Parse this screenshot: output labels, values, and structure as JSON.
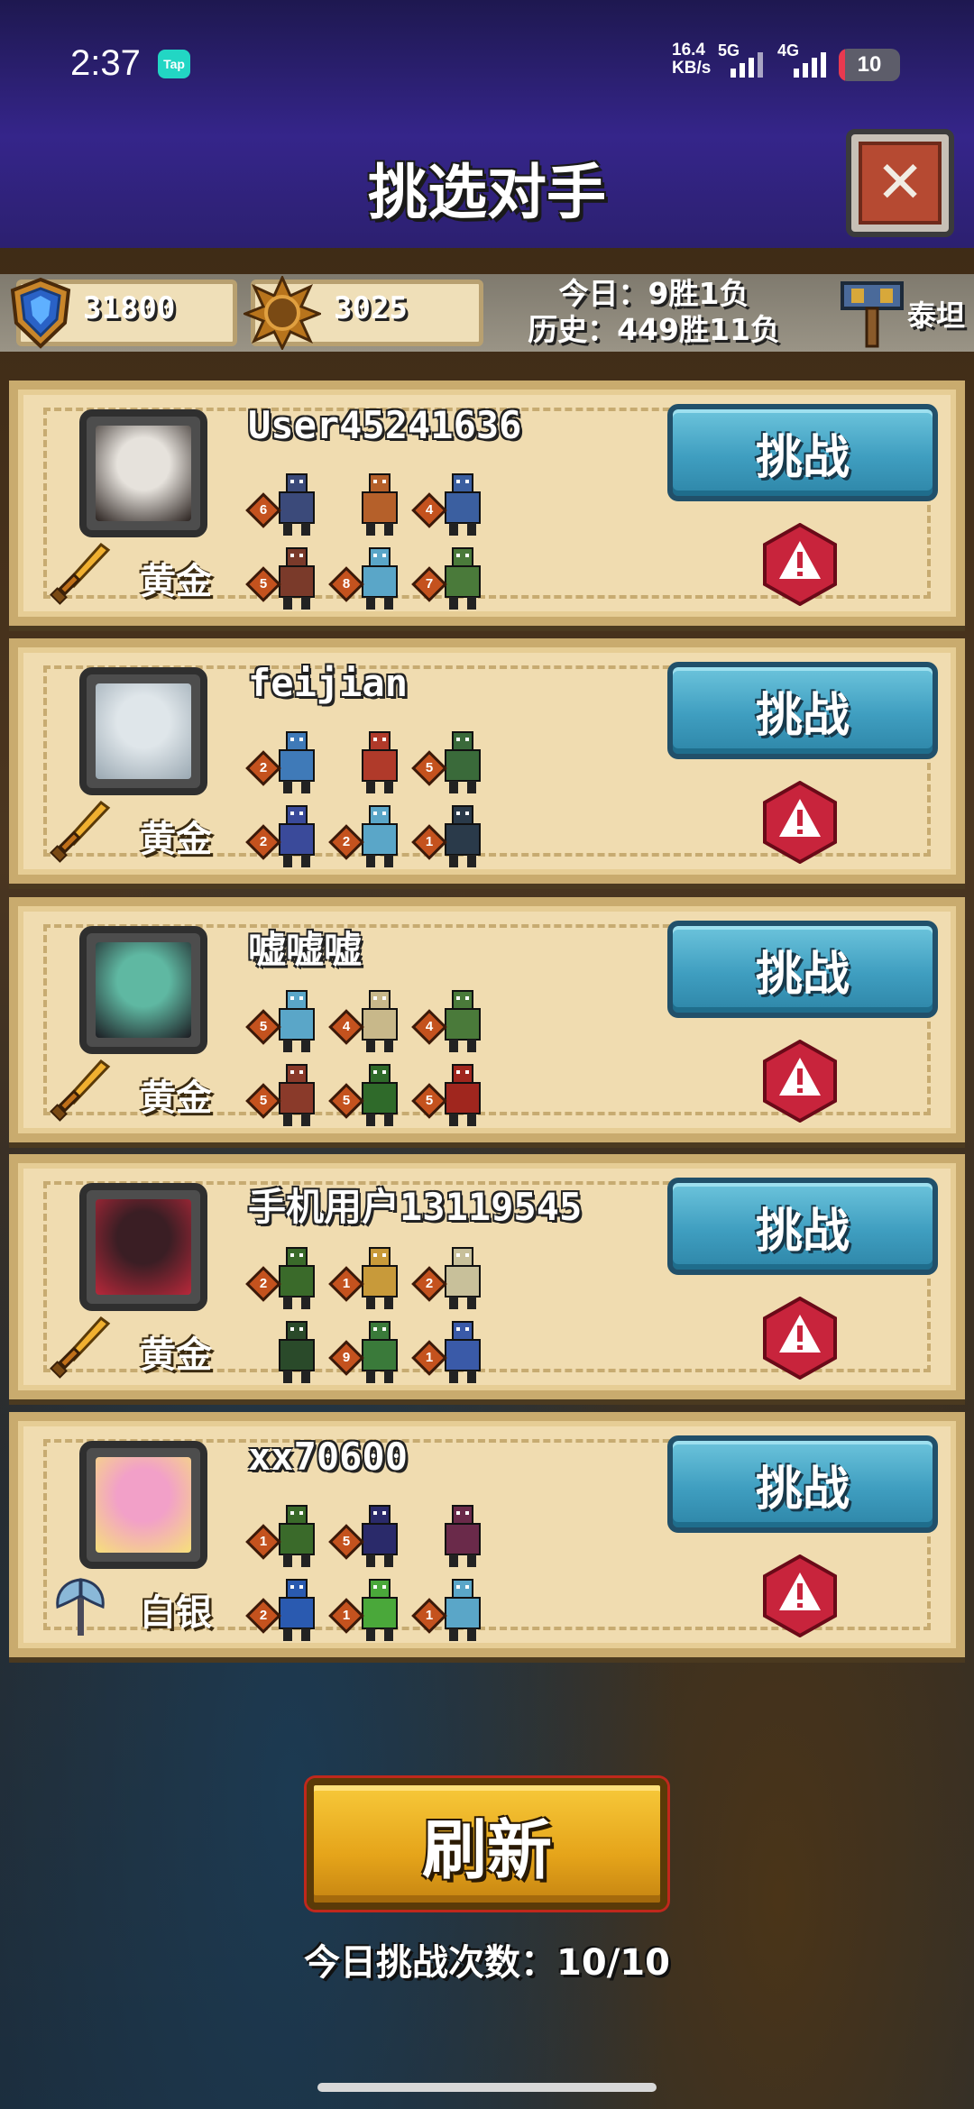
{
  "status_bar": {
    "time": "2:37",
    "app_badge": "Tap",
    "net_speed_value": "16.4",
    "net_speed_unit": "KB/s",
    "net1": "5G",
    "net2": "4G",
    "battery": "10",
    "battery_level_pct": 10
  },
  "header": {
    "title": "挑选对手",
    "close_icon": "close-icon"
  },
  "resources": {
    "trophies": "31800",
    "medals": "3025",
    "today_record": "今日：9胜1负",
    "history_record": "历史：449胜11负",
    "rank": "泰坦"
  },
  "opponents": [
    {
      "name": "User45241636",
      "tier": "黄金",
      "tier_icon": "golden-sword-icon",
      "avatar_colors": [
        "#e6e2dc",
        "#2b2320"
      ],
      "units": [
        {
          "level": "6",
          "color": "#3b4a7a"
        },
        {
          "level": "",
          "color": "#b5602a"
        },
        {
          "level": "4",
          "color": "#3b5fa0"
        },
        {
          "level": "5",
          "color": "#7a3a2a"
        },
        {
          "level": "8",
          "color": "#5aa6c8"
        },
        {
          "level": "7",
          "color": "#4a7a3a"
        }
      ],
      "challenge_label": "挑战"
    },
    {
      "name": "feijian",
      "tier": "黄金",
      "tier_icon": "golden-sword-icon",
      "avatar_colors": [
        "#dfe6ea",
        "#9aa8b2"
      ],
      "units": [
        {
          "level": "2",
          "color": "#3f7ab8"
        },
        {
          "level": "",
          "color": "#b03a2a"
        },
        {
          "level": "5",
          "color": "#3a6a3a"
        },
        {
          "level": "2",
          "color": "#3a4a9a"
        },
        {
          "level": "2",
          "color": "#5aa6c8"
        },
        {
          "level": "1",
          "color": "#2a3a4a"
        }
      ],
      "challenge_label": "挑战"
    },
    {
      "name": "嘘嘘嘘",
      "tier": "黄金",
      "tier_icon": "golden-sword-icon",
      "avatar_colors": [
        "#5fb8a2",
        "#1c1c22"
      ],
      "units": [
        {
          "level": "5",
          "color": "#5aa6c8"
        },
        {
          "level": "4",
          "color": "#c8b88a"
        },
        {
          "level": "4",
          "color": "#4a7a3a"
        },
        {
          "level": "5",
          "color": "#8a3a2a"
        },
        {
          "level": "5",
          "color": "#2f6a2a"
        },
        {
          "level": "5",
          "color": "#a0261e"
        }
      ],
      "challenge_label": "挑战"
    },
    {
      "name": "手机用户13119545",
      "tier": "黄金",
      "tier_icon": "golden-sword-icon",
      "avatar_colors": [
        "#3a1e24",
        "#b8283a"
      ],
      "units": [
        {
          "level": "2",
          "color": "#3a6a2a"
        },
        {
          "level": "1",
          "color": "#c89a3a"
        },
        {
          "level": "2",
          "color": "#c8c09a"
        },
        {
          "level": "",
          "color": "#2a4a2a"
        },
        {
          "level": "9",
          "color": "#3a7a3a"
        },
        {
          "level": "1",
          "color": "#3a5aa8"
        }
      ],
      "challenge_label": "挑战"
    },
    {
      "name": "xx70600",
      "tier": "白银",
      "tier_icon": "silver-axe-icon",
      "avatar_colors": [
        "#f2a0c8",
        "#f6e07a"
      ],
      "units": [
        {
          "level": "1",
          "color": "#3a6a2a"
        },
        {
          "level": "5",
          "color": "#2a2a6a"
        },
        {
          "level": "",
          "color": "#6a2a4a"
        },
        {
          "level": "2",
          "color": "#2a5ab0"
        },
        {
          "level": "1",
          "color": "#4aa83a"
        },
        {
          "level": "1",
          "color": "#5aa6c8"
        }
      ],
      "challenge_label": "挑战"
    }
  ],
  "refresh_label": "刷新",
  "daily_challenges": "今日挑战次数：10/10"
}
